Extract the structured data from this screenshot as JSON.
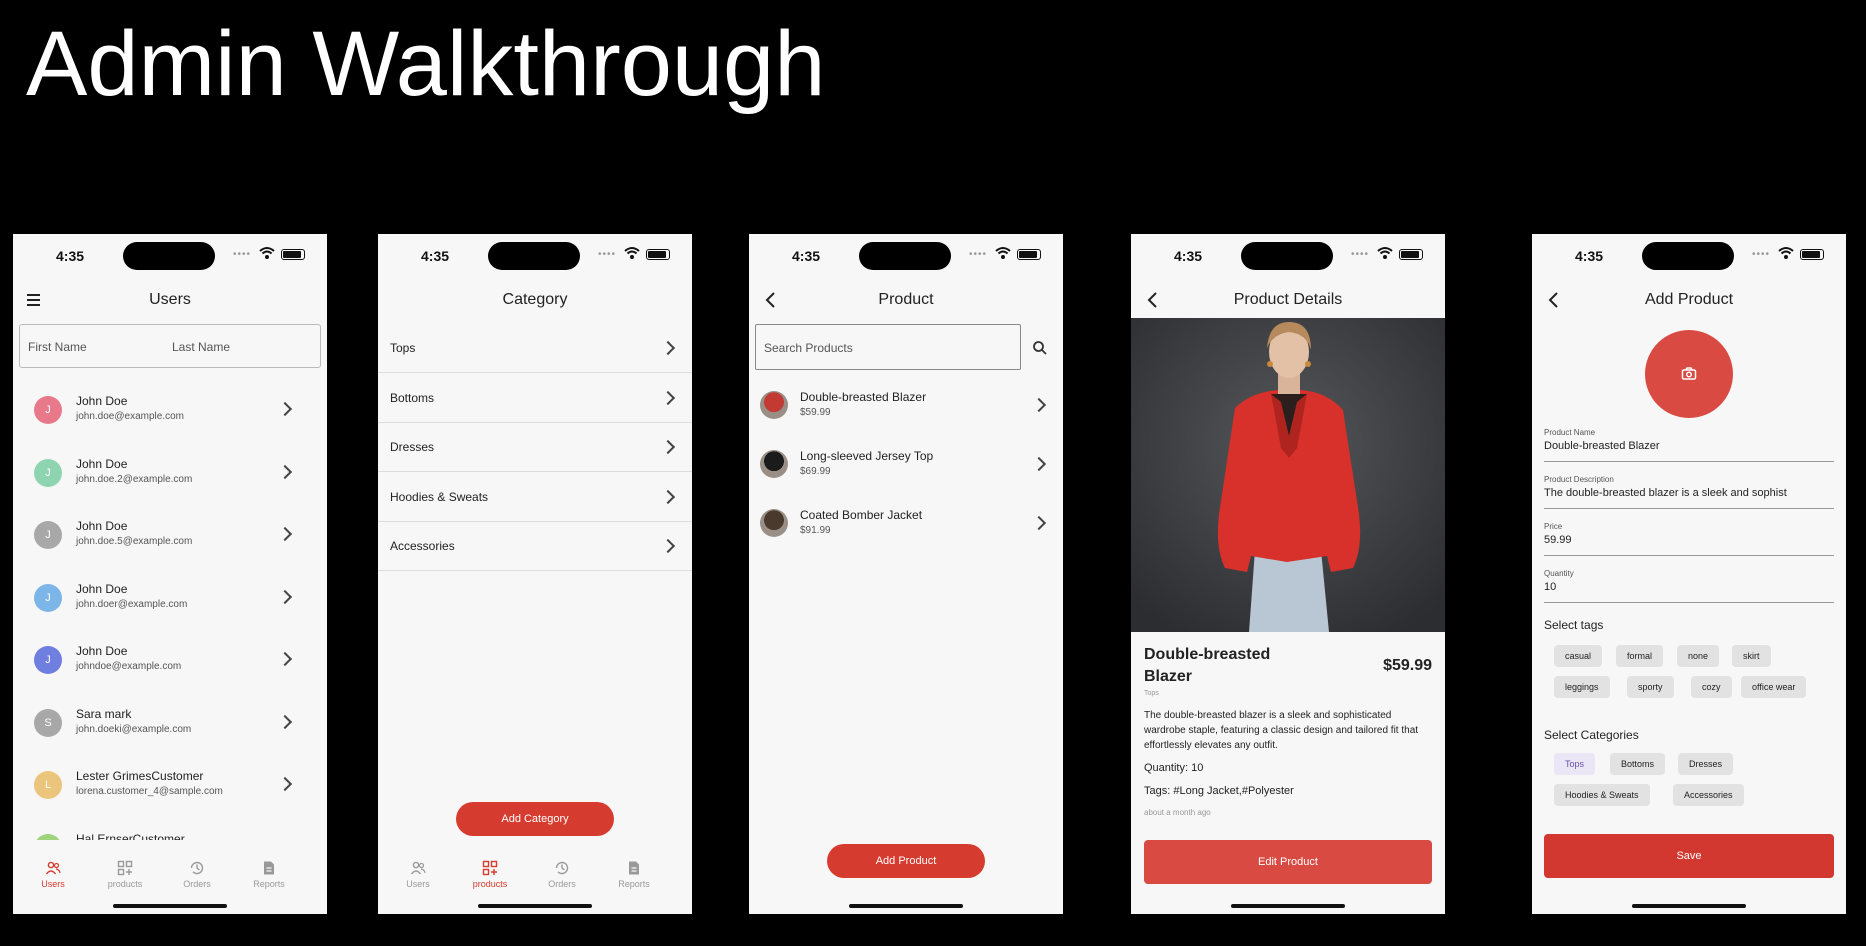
{
  "title": "Admin Walkthrough",
  "status_time": "4:35",
  "users": {
    "title": "Users",
    "first_name_placeholder": "First Name",
    "last_name_placeholder": "Last Name",
    "items": [
      {
        "initial": "J",
        "name": "John Doe",
        "email": "john.doe@example.com",
        "color": "#e8798b"
      },
      {
        "initial": "J",
        "name": "John Doe",
        "email": "john.doe.2@example.com",
        "color": "#8fd4b0"
      },
      {
        "initial": "J",
        "name": "John Doe",
        "email": "john.doe.5@example.com",
        "color": "#a8a8a8"
      },
      {
        "initial": "J",
        "name": "John Doe",
        "email": "john.doer@example.com",
        "color": "#7cb6e8"
      },
      {
        "initial": "J",
        "name": "John Doe",
        "email": "johndoe@example.com",
        "color": "#6f7fe0"
      },
      {
        "initial": "S",
        "name": "Sara mark",
        "email": "john.doeki@example.com",
        "color": "#a8a8a8"
      },
      {
        "initial": "L",
        "name": "Lester GrimesCustomer",
        "email": "lorena.customer_4@sample.com",
        "color": "#ebc57c"
      },
      {
        "initial": "H",
        "name": "Hal ErnserCustomer",
        "email": "",
        "color": "#9fd47a"
      }
    ]
  },
  "tabs": [
    "Users",
    "products",
    "Orders",
    "Reports"
  ],
  "category": {
    "title": "Category",
    "items": [
      "Tops",
      "Bottoms",
      "Dresses",
      "Hoodies & Sweats",
      "Accessories"
    ],
    "add_button": "Add Category"
  },
  "product": {
    "title": "Product",
    "search_placeholder": "Search Products",
    "items": [
      {
        "name": "Double-breasted Blazer",
        "price": "$59.99",
        "color": "#c23a33"
      },
      {
        "name": "Long-sleeved Jersey Top",
        "price": "$69.99",
        "color": "#1b1b1b"
      },
      {
        "name": "Coated Bomber Jacket",
        "price": "$91.99",
        "color": "#4a3a2e"
      }
    ],
    "add_button": "Add Product"
  },
  "details": {
    "title": "Product Details",
    "name": "Double-breasted Blazer",
    "price": "$59.99",
    "category": "Tops",
    "description": "The double-breasted blazer is a sleek and sophisticated wardrobe staple, featuring a classic design and tailored fit that effortlessly elevates any outfit.",
    "quantity": "Quantity: 10",
    "tags": "Tags: #Long Jacket,#Polyester",
    "time": "about a month ago",
    "edit_button": "Edit Product"
  },
  "add_product": {
    "title": "Add Product",
    "fields": [
      {
        "label": "Product Name",
        "value": "Double-breasted Blazer"
      },
      {
        "label": "Product Description",
        "value": "The double-breasted blazer is a sleek and sophist"
      },
      {
        "label": "Price",
        "value": "59.99"
      },
      {
        "label": "Quantity",
        "value": "10"
      }
    ],
    "tags_title": "Select tags",
    "tags": [
      "casual",
      "formal",
      "none",
      "skirt",
      "leggings",
      "sporty",
      "cozy",
      "office wear"
    ],
    "categories_title": "Select Categories",
    "categories": [
      "Tops",
      "Bottoms",
      "Dresses",
      "Hoodies & Sweats",
      "Accessories"
    ],
    "selected_category": "Tops",
    "save_button": "Save"
  },
  "colors": {
    "accent": "#d63b2f",
    "button": "#d94b42"
  }
}
